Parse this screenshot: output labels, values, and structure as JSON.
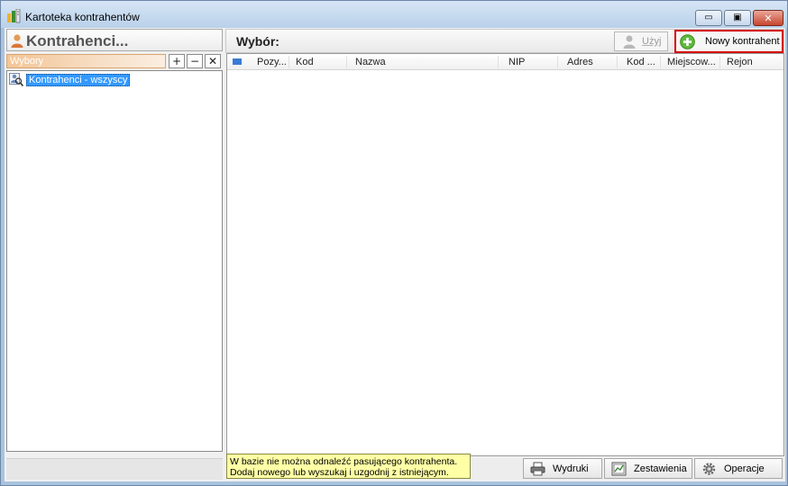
{
  "window": {
    "title": "Kartoteka kontrahentów",
    "controls": {
      "minimize": "▭",
      "maximize": "▣",
      "close": "✕"
    }
  },
  "left_panel": {
    "title": "Kontrahenci...",
    "selections_label": "Wybory",
    "buttons": {
      "add": "+",
      "remove": "−",
      "close": "✕"
    },
    "tree": [
      {
        "label": "Kontrahenci - wszyscy",
        "icon": "search-person-icon",
        "selected": true
      }
    ]
  },
  "right_panel": {
    "selection_label": "Wybór:",
    "toolbar": {
      "use_label": "Użyj",
      "new_contractor_label": "Nowy kontrahent"
    },
    "columns": [
      "Pozy...",
      "Kod",
      "Nazwa",
      "NIP",
      "Adres",
      "Kod ...",
      "Miejscow...",
      "Rejon"
    ],
    "rows": [],
    "hint_lines": [
      "W bazie nie można odnaleźć pasującego  kontrahenta.",
      "Dodaj nowego lub wyszukaj i uzgodnij z istniejącym."
    ],
    "bottom_buttons": {
      "prints": "Wydruki",
      "reports": "Zestawienia",
      "operations": "Operacje"
    }
  },
  "colors": {
    "accent_red": "#d40000",
    "selection_blue": "#3399ff",
    "hint_yellow": "#ffffa6"
  }
}
